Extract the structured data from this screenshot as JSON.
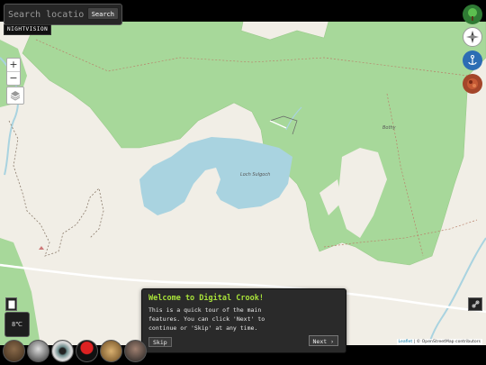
{
  "search": {
    "placeholder": "Search location",
    "button_label": "Search"
  },
  "mode_label": "NIGHTVISION",
  "zoom": {
    "in_label": "+",
    "out_label": "−"
  },
  "map_labels": {
    "lake": "Loch Sulgoch",
    "building": "Bothy"
  },
  "tour": {
    "title": "Welcome to Digital Crook!",
    "body": "This is a quick tour of the main\nfeatures. You can click 'Next' to\ncontinue or 'Skip' at any time.",
    "skip_label": "Skip",
    "next_label": "Next ›"
  },
  "temperature_label": "8℃",
  "attribution": {
    "leaflet": "Leaflet",
    "rest": " | © OpenStreetMap contributors"
  },
  "right_buttons": [
    "tree-icon",
    "compass-icon",
    "anchor-icon",
    "terrain-icon"
  ],
  "bottom_icons": [
    "walker-avatar",
    "wolf-avatar",
    "eye-avatar",
    "mushroom-avatar",
    "compass-rose-avatar",
    "person-avatar"
  ],
  "colors": {
    "forest": "#a7d89a",
    "water": "#a9d3e0",
    "land": "#f1eee6",
    "accent": "#a8e23a",
    "panel": "#2a2a2a"
  }
}
